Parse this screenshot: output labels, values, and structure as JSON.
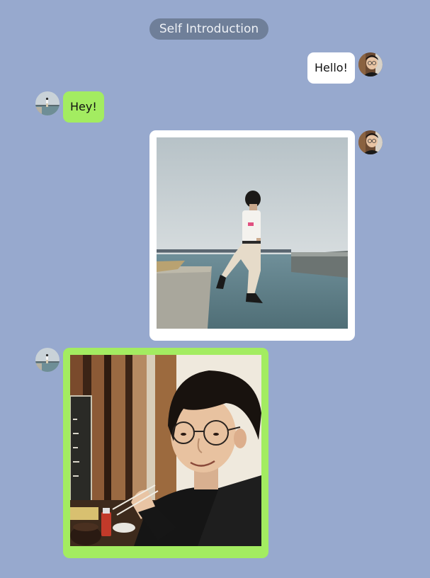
{
  "header": {
    "title": "Self Introduction"
  },
  "messages": [
    {
      "side": "right",
      "kind": "text",
      "text": "Hello!",
      "avatar": "user-avatar-man-glasses"
    },
    {
      "side": "left",
      "kind": "text",
      "text": "Hey!",
      "avatar": "contact-avatar-seaside"
    },
    {
      "side": "right",
      "kind": "photo",
      "avatar": "user-avatar-man-glasses",
      "photo": "man-jumping-by-sea-photo"
    },
    {
      "side": "left",
      "kind": "photo",
      "avatar": "contact-avatar-seaside",
      "photo": "man-with-glasses-eating-photo"
    }
  ],
  "colors": {
    "background": "#97a9ce",
    "title_pill": "#6f7f99",
    "bubble_self": "#ffffff",
    "bubble_other": "#a3ec61"
  }
}
